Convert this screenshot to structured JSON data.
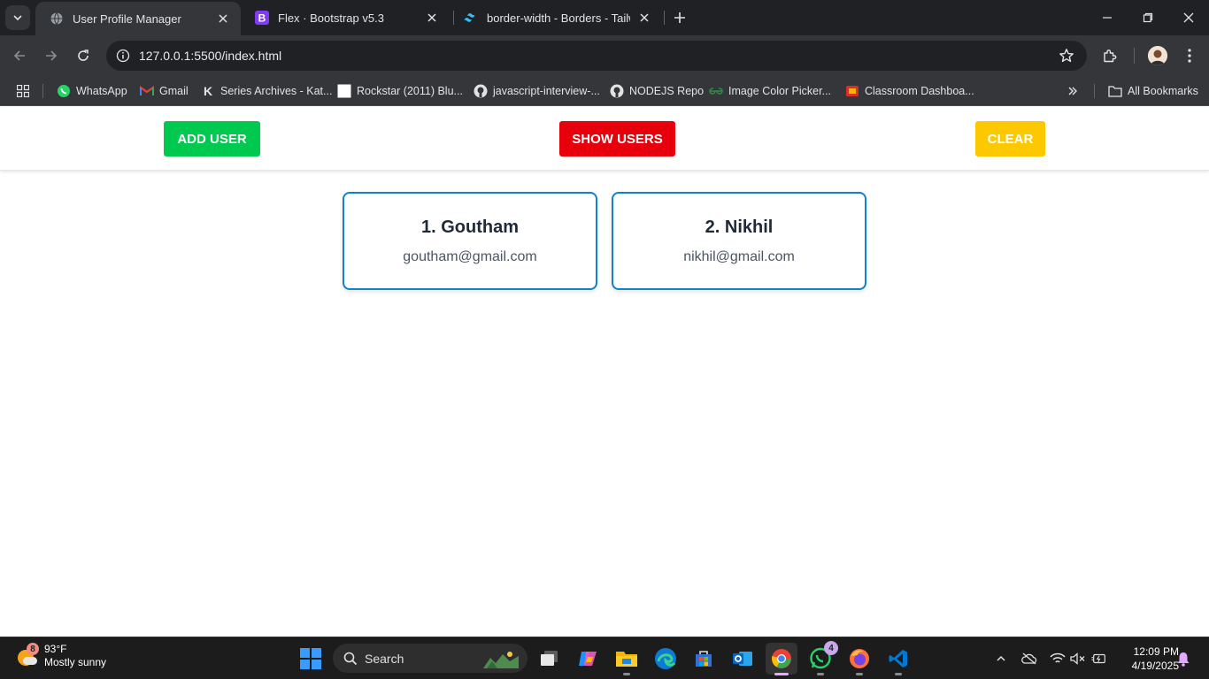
{
  "browser": {
    "tabs": [
      {
        "title": "User Profile Manager",
        "active": true
      },
      {
        "title": "Flex · Bootstrap v5.3",
        "active": false
      },
      {
        "title": "border-width - Borders - Tailwi",
        "active": false
      }
    ],
    "url": "127.0.0.1:5500/index.html",
    "bookmarks": [
      "WhatsApp",
      "Gmail",
      "Series Archives - Kat...",
      "Rockstar (2011) Blu...",
      "javascript-interview-...",
      "NODEJS Repo",
      "Image Color Picker...",
      "Classroom Dashboa..."
    ],
    "all_bookmarks_label": "All Bookmarks"
  },
  "page": {
    "buttons": {
      "add_user": "ADD USER",
      "show_users": "SHOW USERS",
      "clear": "CLEAR"
    },
    "users": [
      {
        "name": "1. Goutham",
        "email": "goutham@gmail.com"
      },
      {
        "name": "2. Nikhil",
        "email": "nikhil@gmail.com"
      }
    ],
    "colors": {
      "add": "#00c950",
      "show": "#e7000b",
      "clear": "#fcc800",
      "card_border": "#0f84c9"
    }
  },
  "taskbar": {
    "weather": {
      "temp": "93°F",
      "condition": "Mostly sunny",
      "badge": "8"
    },
    "search_label": "Search",
    "whatsapp_badge": "4",
    "time": "12:09 PM",
    "date": "4/19/2025"
  }
}
